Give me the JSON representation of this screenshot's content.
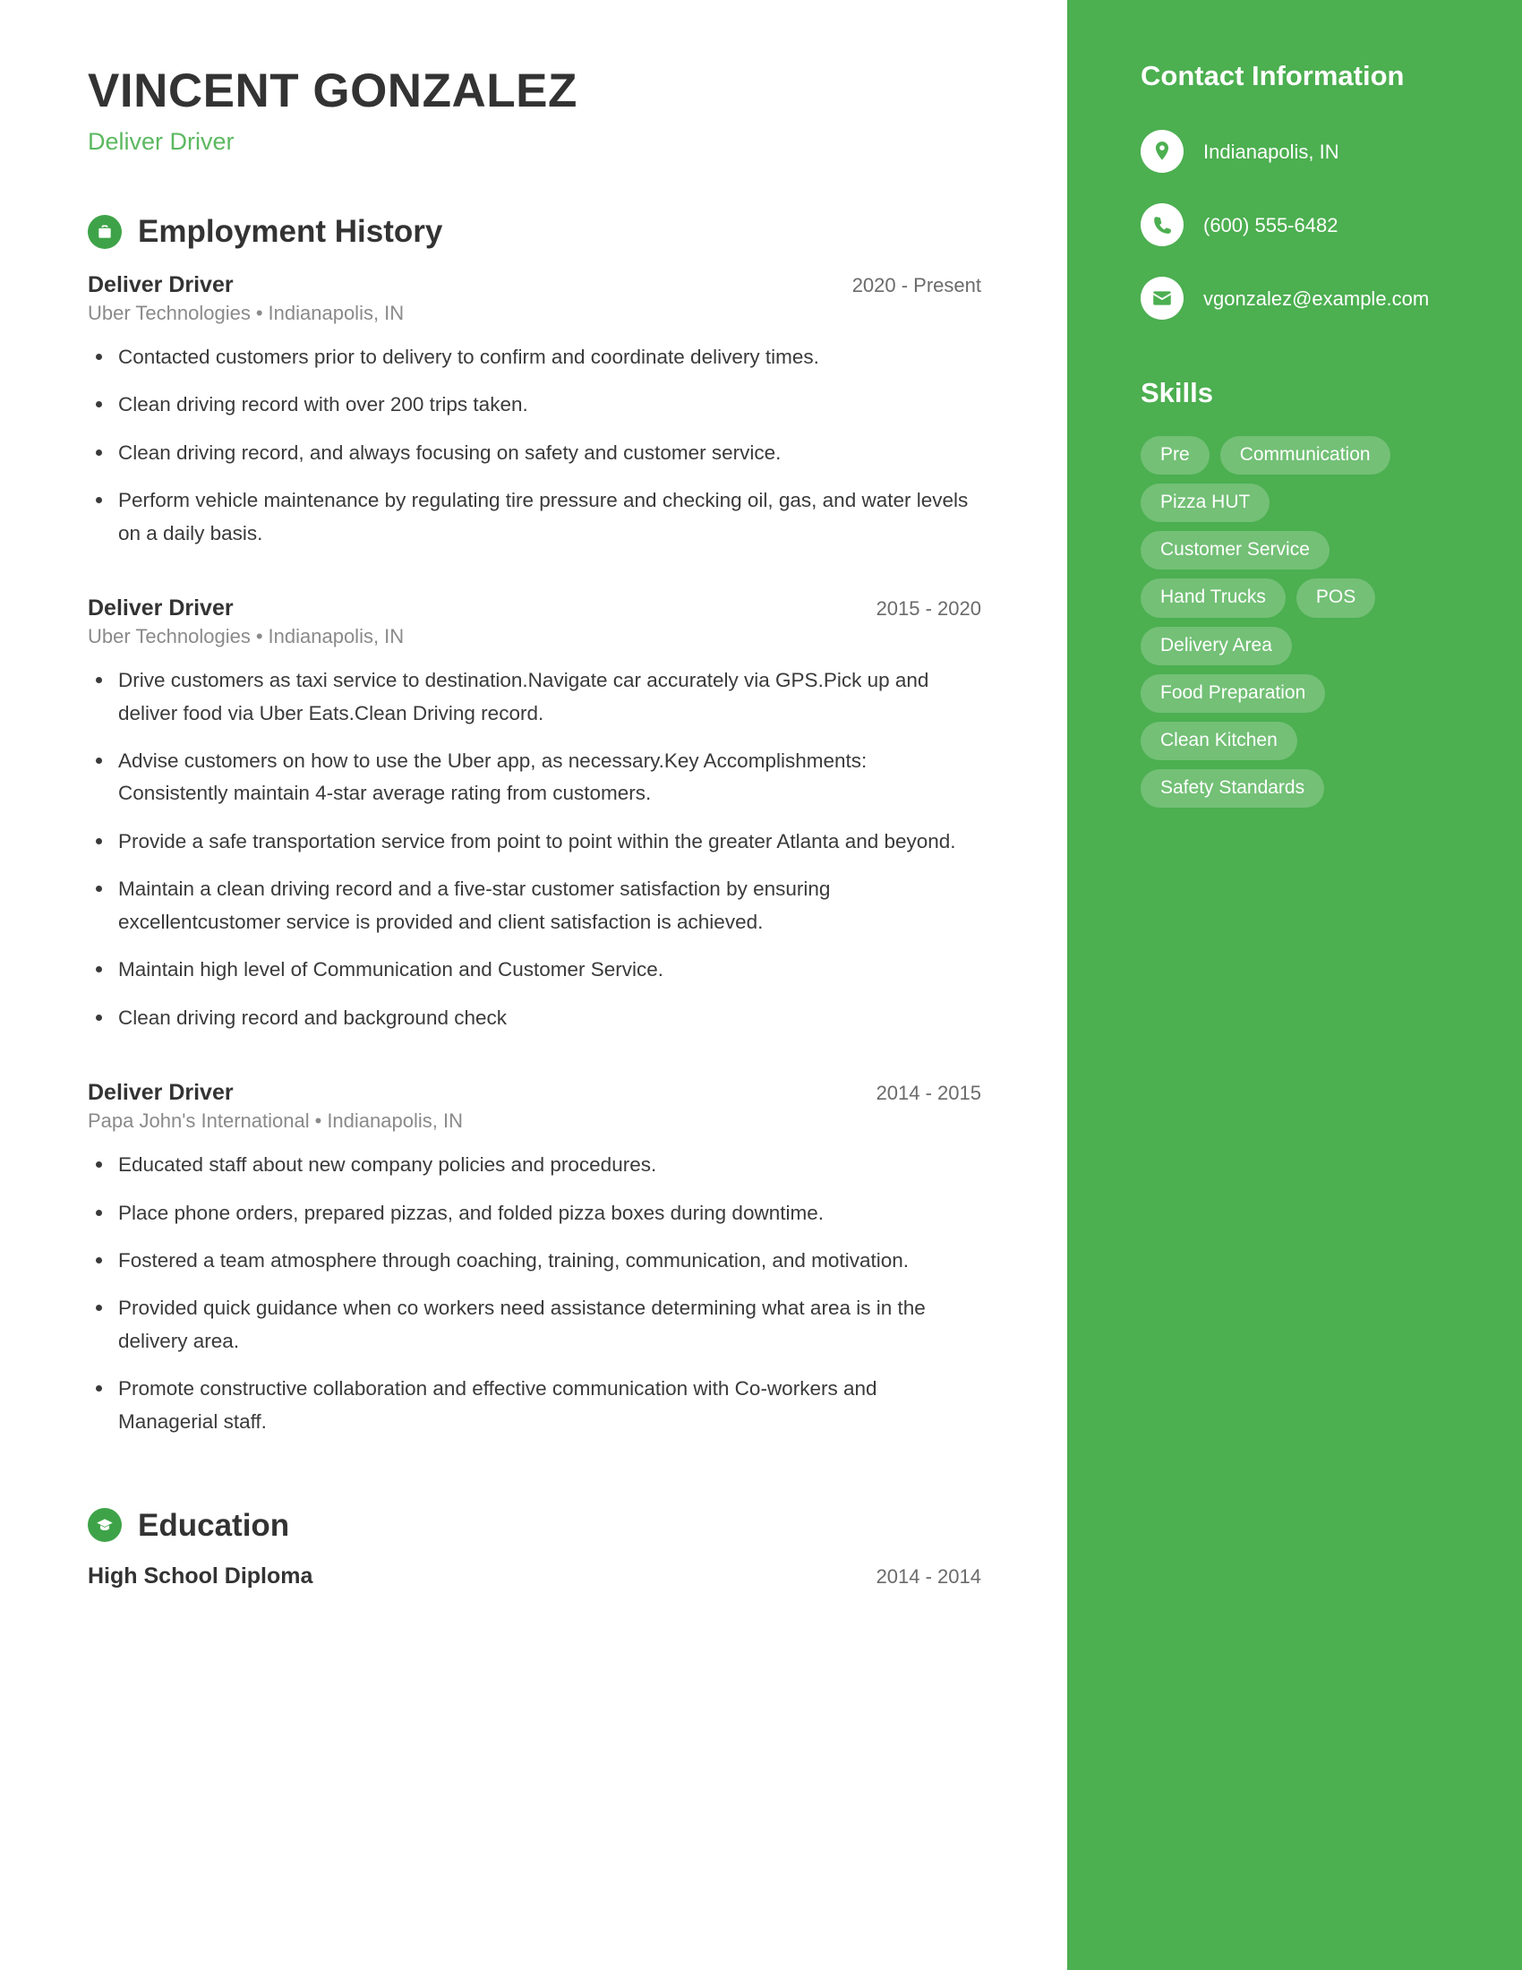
{
  "header": {
    "name": "VINCENT GONZALEZ",
    "headline": "Deliver Driver"
  },
  "employment": {
    "section_title": "Employment History",
    "icon": "briefcase-icon",
    "entries": [
      {
        "role": "Deliver Driver",
        "dates": "2020 - Present",
        "company": "Uber Technologies",
        "separator": "•",
        "location": "Indianapolis, IN",
        "bullets": [
          "Contacted customers prior to delivery to confirm and coordinate delivery times.",
          "Clean driving record with over 200 trips taken.",
          "Clean driving record, and always focusing on safety and customer service.",
          "Perform vehicle maintenance by regulating tire pressure and checking oil, gas, and water levels on a daily basis."
        ]
      },
      {
        "role": "Deliver Driver",
        "dates": "2015 - 2020",
        "company": "Uber Technologies",
        "separator": "•",
        "location": "Indianapolis, IN",
        "bullets": [
          "Drive customers as taxi service to destination.Navigate car accurately via GPS.Pick up and deliver food via Uber Eats.Clean Driving record.",
          "Advise customers on how to use the Uber app, as necessary.Key Accomplishments: Consistently maintain 4-star average rating from customers.",
          "Provide a safe transportation service from point to point within the greater Atlanta and beyond.",
          "Maintain a clean driving record and a five-star customer satisfaction by ensuring excellentcustomer service is provided and client satisfaction is achieved.",
          "Maintain high level of Communication and Customer Service.",
          "Clean driving record and background check"
        ]
      },
      {
        "role": "Deliver Driver",
        "dates": "2014 - 2015",
        "company": "Papa John's International",
        "separator": "•",
        "location": "Indianapolis, IN",
        "bullets": [
          "Educated staff about new company policies and procedures.",
          "Place phone orders, prepared pizzas, and folded pizza boxes during downtime.",
          "Fostered a team atmosphere through coaching, training, communication, and motivation.",
          "Provided quick guidance when co workers need assistance determining what area is in the delivery area.",
          "Promote constructive collaboration and effective communication with Co-workers and Managerial staff."
        ]
      }
    ]
  },
  "education": {
    "section_title": "Education",
    "icon": "graduation-cap-icon",
    "entries": [
      {
        "degree": "High School Diploma",
        "dates": "2014 - 2014"
      }
    ]
  },
  "sidebar": {
    "contact_title": "Contact Information",
    "contacts": [
      {
        "icon": "location-pin-icon",
        "value": "Indianapolis, IN"
      },
      {
        "icon": "phone-icon",
        "value": "(600) 555-6482"
      },
      {
        "icon": "email-icon",
        "value": "vgonzalez@example.com"
      }
    ],
    "skills_title": "Skills",
    "skills": [
      "Pre",
      "Communication",
      "Pizza HUT",
      "Customer Service",
      "Hand Trucks",
      "POS",
      "Delivery Area",
      "Food Preparation",
      "Clean Kitchen",
      "Safety Standards"
    ]
  },
  "colors": {
    "sidebar_green": "#4caf50",
    "accent_green": "#5cb860",
    "icon_green": "#3ea348",
    "text_dark": "#333333",
    "text_muted": "#8a8a8a"
  }
}
